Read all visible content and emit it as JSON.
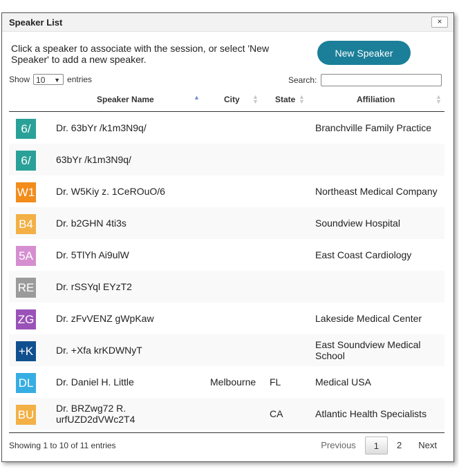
{
  "dialog": {
    "title": "Speaker List",
    "close_label": "×"
  },
  "intro_text": "Click a speaker to associate with the session, or select 'New Speaker' to add a new speaker.",
  "new_speaker_label": "New Speaker",
  "length": {
    "show_label": "Show",
    "value": "10",
    "entries_label": "entries"
  },
  "search": {
    "label": "Search:",
    "value": ""
  },
  "columns": {
    "name": "Speaker Name",
    "city": "City",
    "state": "State",
    "affiliation": "Affiliation"
  },
  "rows": [
    {
      "initials": "6/",
      "color": "#2aa198",
      "name": "Dr. 63bYr /k1m3N9q/",
      "city": "",
      "state": "",
      "affiliation": "Branchville Family Practice"
    },
    {
      "initials": "6/",
      "color": "#2aa198",
      "name": "63bYr /k1m3N9q/",
      "city": "",
      "state": "",
      "affiliation": ""
    },
    {
      "initials": "W1",
      "color": "#f28c1a",
      "name": "Dr. W5Kiy z. 1CeROuO/6",
      "city": "",
      "state": "",
      "affiliation": "Northeast Medical Company"
    },
    {
      "initials": "B4",
      "color": "#f2b046",
      "name": "Dr. b2GHN 4ti3s",
      "city": "",
      "state": "",
      "affiliation": "Soundview Hospital"
    },
    {
      "initials": "5A",
      "color": "#d58fd0",
      "name": "Dr. 5TlYh Ai9ulW",
      "city": "",
      "state": "",
      "affiliation": "East Coast Cardiology"
    },
    {
      "initials": "RE",
      "color": "#9b9b9b",
      "name": "Dr. rSSYql EYzT2",
      "city": "",
      "state": "",
      "affiliation": ""
    },
    {
      "initials": "ZG",
      "color": "#9a52b8",
      "name": "Dr. zFvVENZ gWpKaw",
      "city": "",
      "state": "",
      "affiliation": "Lakeside Medical Center"
    },
    {
      "initials": "+K",
      "color": "#11508f",
      "name": "Dr. +Xfa krKDWNyT",
      "city": "",
      "state": "",
      "affiliation": "East Soundview Medical School"
    },
    {
      "initials": "DL",
      "color": "#37aee3",
      "name": "Dr. Daniel H. Little",
      "city": "Melbourne",
      "state": "FL",
      "affiliation": "Medical USA"
    },
    {
      "initials": "BU",
      "color": "#f2b046",
      "name": "Dr. BRZwg72 R. urfUZD2dVWc2T4",
      "city": "",
      "state": "CA",
      "affiliation": "Atlantic Health Specialists"
    }
  ],
  "footer": {
    "info": "Showing 1 to 10 of 11 entries",
    "previous": "Previous",
    "page1": "1",
    "page2": "2",
    "next": "Next"
  }
}
